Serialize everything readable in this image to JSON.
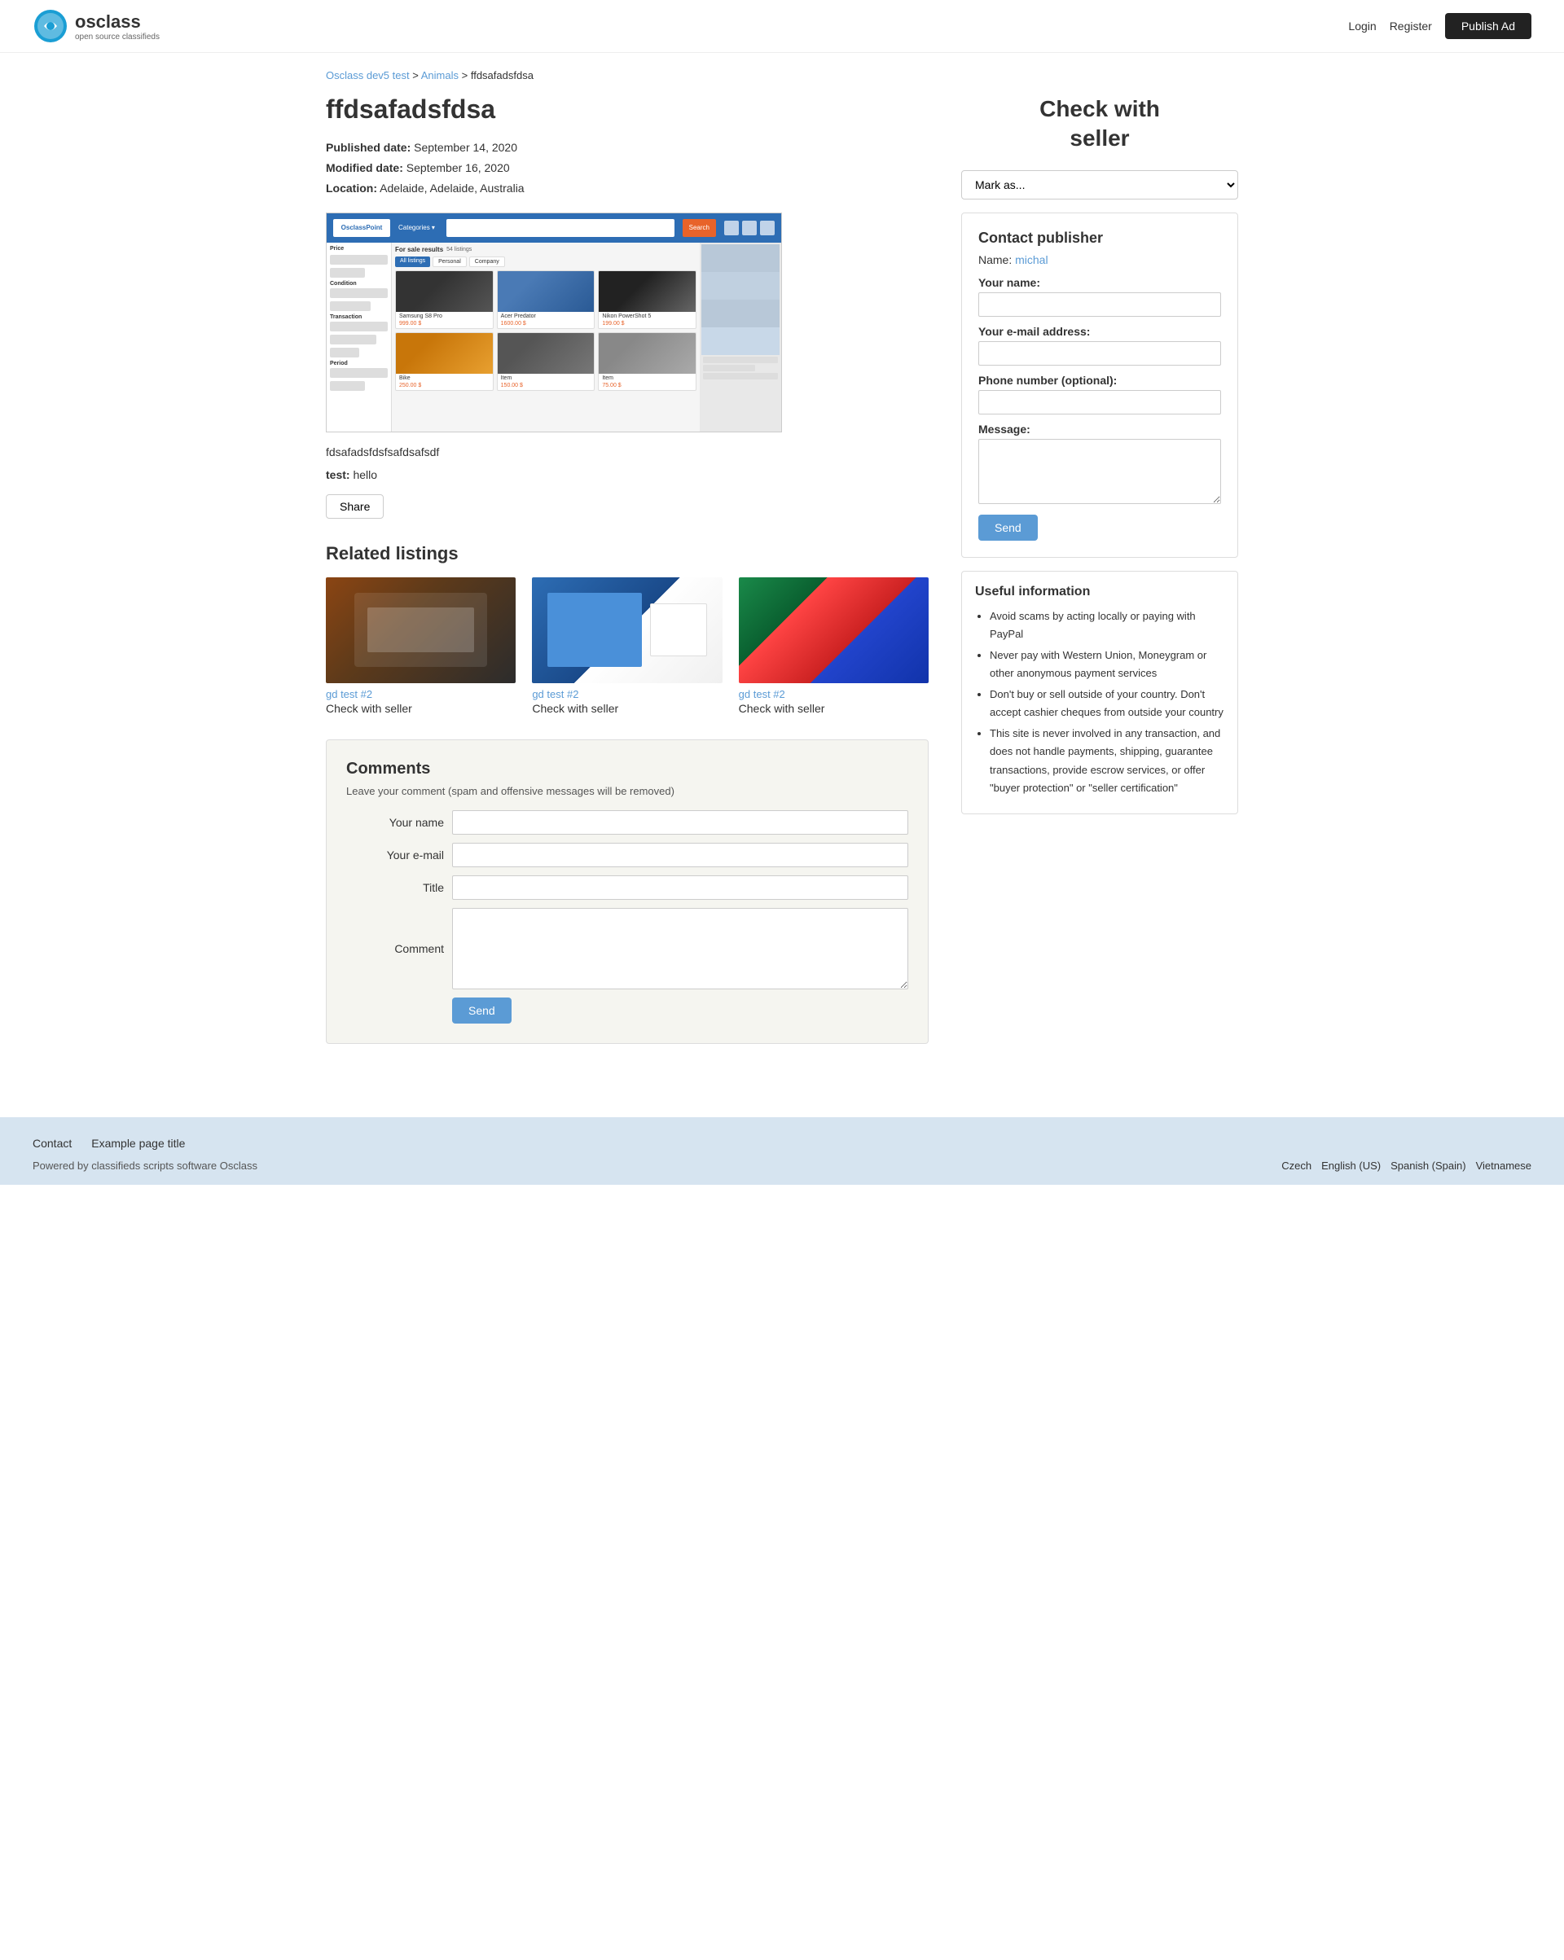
{
  "header": {
    "brand": "osclass",
    "tagline": "open source classifieds",
    "nav": {
      "login": "Login",
      "register": "Register",
      "publish_ad": "Publish Ad"
    }
  },
  "breadcrumb": {
    "home": "Osclass dev5 test",
    "category": "Animals",
    "current": "ffdsafadsfdsa"
  },
  "listing": {
    "title": "ffdsafadsfdsa",
    "published_label": "Published date:",
    "published_date": "September 14, 2020",
    "modified_label": "Modified date:",
    "modified_date": "September 16, 2020",
    "location_label": "Location:",
    "location": "Adelaide, Adelaide, Australia",
    "description": "fdsafadsfdsfsafdsafsdf",
    "test_label": "test:",
    "test_value": "hello",
    "share_btn": "Share"
  },
  "sidebar": {
    "check_title_line1": "Check with",
    "check_title_line2": "seller",
    "mark_as_placeholder": "Mark as...",
    "contact": {
      "title": "Contact publisher",
      "name_label": "Name:",
      "name_value": "michal",
      "your_name_label": "Your name:",
      "email_label": "Your e-mail address:",
      "phone_label": "Phone number (optional):",
      "message_label": "Message:",
      "send_btn": "Send"
    },
    "useful_info": {
      "title": "Useful information",
      "items": [
        "Avoid scams by acting locally or paying with PayPal",
        "Never pay with Western Union, Moneygram or other anonymous payment services",
        "Don't buy or sell outside of your country. Don't accept cashier cheques from outside your country",
        "This site is never involved in any transaction, and does not handle payments, shipping, guarantee transactions, provide escrow services, or offer \"buyer protection\" or \"seller certification\""
      ]
    }
  },
  "related_listings": {
    "title": "Related listings",
    "items": [
      {
        "category": "gd test #2",
        "title": "Check with seller",
        "img_class": "img1"
      },
      {
        "category": "gd test #2",
        "title": "Check with seller",
        "img_class": "img2"
      },
      {
        "category": "gd test #2",
        "title": "Check with seller",
        "img_class": "img3"
      }
    ]
  },
  "comments": {
    "title": "Comments",
    "subtitle": "Leave your comment (spam and offensive messages will be removed)",
    "name_label": "Your name",
    "email_label": "Your e-mail",
    "title_label": "Title",
    "comment_label": "Comment",
    "send_btn": "Send"
  },
  "footer": {
    "links": [
      {
        "label": "Contact"
      },
      {
        "label": "Example page title"
      }
    ],
    "powered_by": "Powered by classifieds scripts software Osclass",
    "languages": [
      {
        "label": "Czech"
      },
      {
        "label": "English (US)"
      },
      {
        "label": "Spanish (Spain)"
      },
      {
        "label": "Vietnamese"
      }
    ]
  }
}
